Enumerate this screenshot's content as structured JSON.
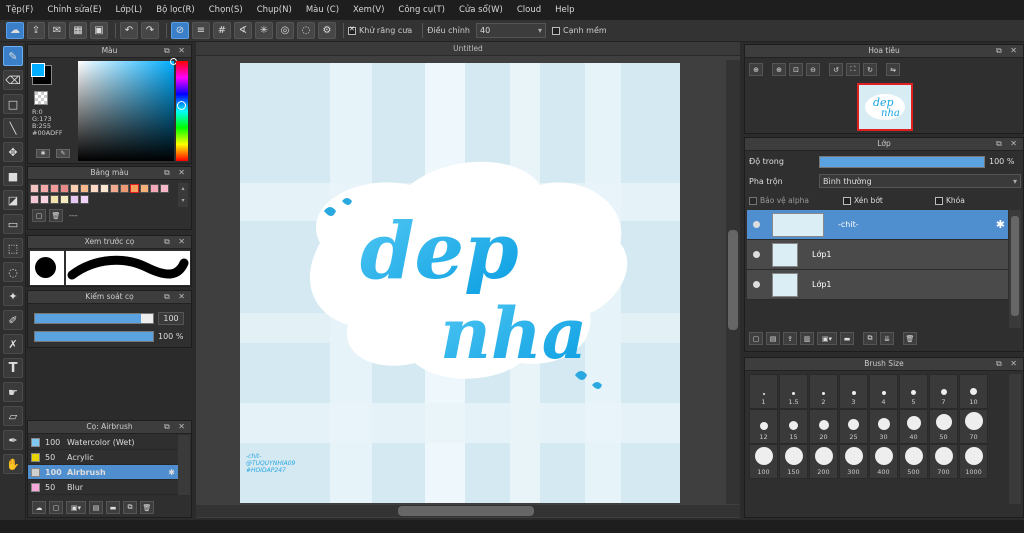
{
  "menu": [
    "Tệp(F)",
    "Chỉnh sửa(E)",
    "Lớp(L)",
    "Bộ lọc(R)",
    "Chọn(S)",
    "Chụp(N)",
    "Màu (C)",
    "Xem(V)",
    "Công cụ(T)",
    "Cửa sổ(W)",
    "Cloud",
    "Help"
  ],
  "toolbar": {
    "antialias_label": "Khử răng cưa",
    "adjust_label": "Điều chỉnh",
    "adjust_value": "40",
    "soft_edge_label": "Cạnh mềm"
  },
  "color_panel": {
    "title": "Màu",
    "r": "R:0",
    "g": "G:173",
    "b": "B:255",
    "hex": "#00ADFF",
    "fg": "#00adff",
    "bg": "#000000"
  },
  "palette_panel": {
    "title": "Bảng màu",
    "swatches": [
      "#f4c1c1",
      "#f6a9a9",
      "#f19b9b",
      "#e98a8a",
      "#fbd0b0",
      "#f7b88c",
      "#ffd8c6",
      "#fbe7cf",
      "#f2aa8e",
      "#ed9a74",
      "#f5a05d",
      "#f7b27a",
      "#f4a8b8",
      "#f7b9c8",
      "#f4c6d6",
      "#fad5e0",
      "#f2e2ac",
      "#f4ecbe",
      "#e6c8f3",
      "#f3d4f9"
    ],
    "dash": "---"
  },
  "preview_panel": {
    "title": "Xem trước cọ"
  },
  "control_panel": {
    "title": "Kiểm soát cọ",
    "size_value": "100",
    "opacity_value": "100 %",
    "size_level": 0.9,
    "opacity_level": 1.0
  },
  "brush_panel": {
    "title": "Cọ: Airbrush",
    "items": [
      {
        "value": "100",
        "name": "Watercolor (Wet)",
        "color": "#7fc8f0"
      },
      {
        "value": "50",
        "name": "Acrylic",
        "color": "#e8d400"
      },
      {
        "value": "100",
        "name": "Airbrush",
        "color": "#d0d0d0"
      },
      {
        "value": "50",
        "name": "Blur",
        "color": "#f7a8d8"
      }
    ]
  },
  "document": {
    "tab": "Untitled",
    "art_title_line1": "dep",
    "art_title_line2": "nha",
    "credit1": "-chit-",
    "credit2": "@TUQUYNHIA09",
    "credit3": "#HOIDAP247"
  },
  "navigator_panel": {
    "title": "Hoa tiêu"
  },
  "layer_panel": {
    "title": "Lớp",
    "opacity_label": "Độ trong",
    "opacity_value": "100 %",
    "opacity_level": 1.0,
    "blend_label": "Pha trộn",
    "blend_value": "Bình thường",
    "protect_alpha": "Bảo vệ alpha",
    "clipping": "Xén bớt",
    "lock": "Khóa",
    "layers": [
      {
        "name": "-chit-",
        "selected": true
      },
      {
        "name": "Lớp1",
        "selected": false
      },
      {
        "name": "Lớp1",
        "selected": false
      }
    ]
  },
  "brush_size_panel": {
    "title": "Brush Size",
    "sizes": [
      "1",
      "1.5",
      "2",
      "3",
      "4",
      "5",
      "7",
      "10",
      "12",
      "15",
      "20",
      "25",
      "30",
      "40",
      "50",
      "70",
      "100",
      "150",
      "200",
      "300",
      "400",
      "500",
      "700",
      "1000"
    ]
  }
}
